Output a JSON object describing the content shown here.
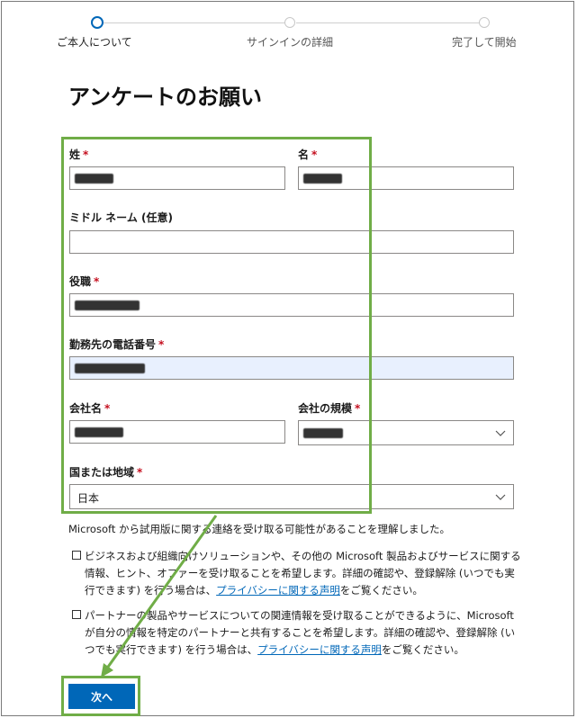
{
  "stepper": {
    "steps": [
      {
        "label": "ご本人について",
        "active": true
      },
      {
        "label": "サインインの詳細",
        "active": false
      },
      {
        "label": "完了して開始",
        "active": false
      }
    ]
  },
  "page": {
    "title": "アンケートのお願い"
  },
  "form": {
    "last_name": {
      "label": "姓",
      "required": "*"
    },
    "first_name": {
      "label": "名",
      "required": "*"
    },
    "middle_name": {
      "label": "ミドル ネーム (任意)"
    },
    "job_title": {
      "label": "役職",
      "required": "*"
    },
    "work_phone": {
      "label": "勤務先の電話番号",
      "required": "*"
    },
    "company": {
      "label": "会社名",
      "required": "*"
    },
    "company_size": {
      "label": "会社の規模",
      "required": "*"
    },
    "country": {
      "label": "国または地域",
      "required": "*",
      "value": "日本"
    }
  },
  "consent": {
    "notice": "Microsoft から試用版に関する連絡を受け取る可能性があることを理解しました。",
    "option1": {
      "text_before": "ビジネスおよび組織向けソリューションや、その他の Microsoft 製品およびサービスに関する情報、ヒント、オファーを受け取ることを希望します。詳細の確認や、登録解除 (いつでも実行できます) を行う場合は、",
      "link": "プライバシーに関する声明",
      "text_after": "をご覧ください。"
    },
    "option2": {
      "text_before": "パートナーの製品やサービスについての関連情報を受け取ることができるように、Microsoft が自分の情報を特定のパートナーと共有することを希望します。詳細の確認や、登録解除 (いつでも実行できます) を行う場合は、",
      "link": "プライバシーに関する声明",
      "text_after": "をご覧ください。"
    }
  },
  "actions": {
    "next_label": "次へ"
  },
  "colors": {
    "accent": "#0067b8",
    "highlight": "#70ad47",
    "required": "#c50f1f"
  }
}
